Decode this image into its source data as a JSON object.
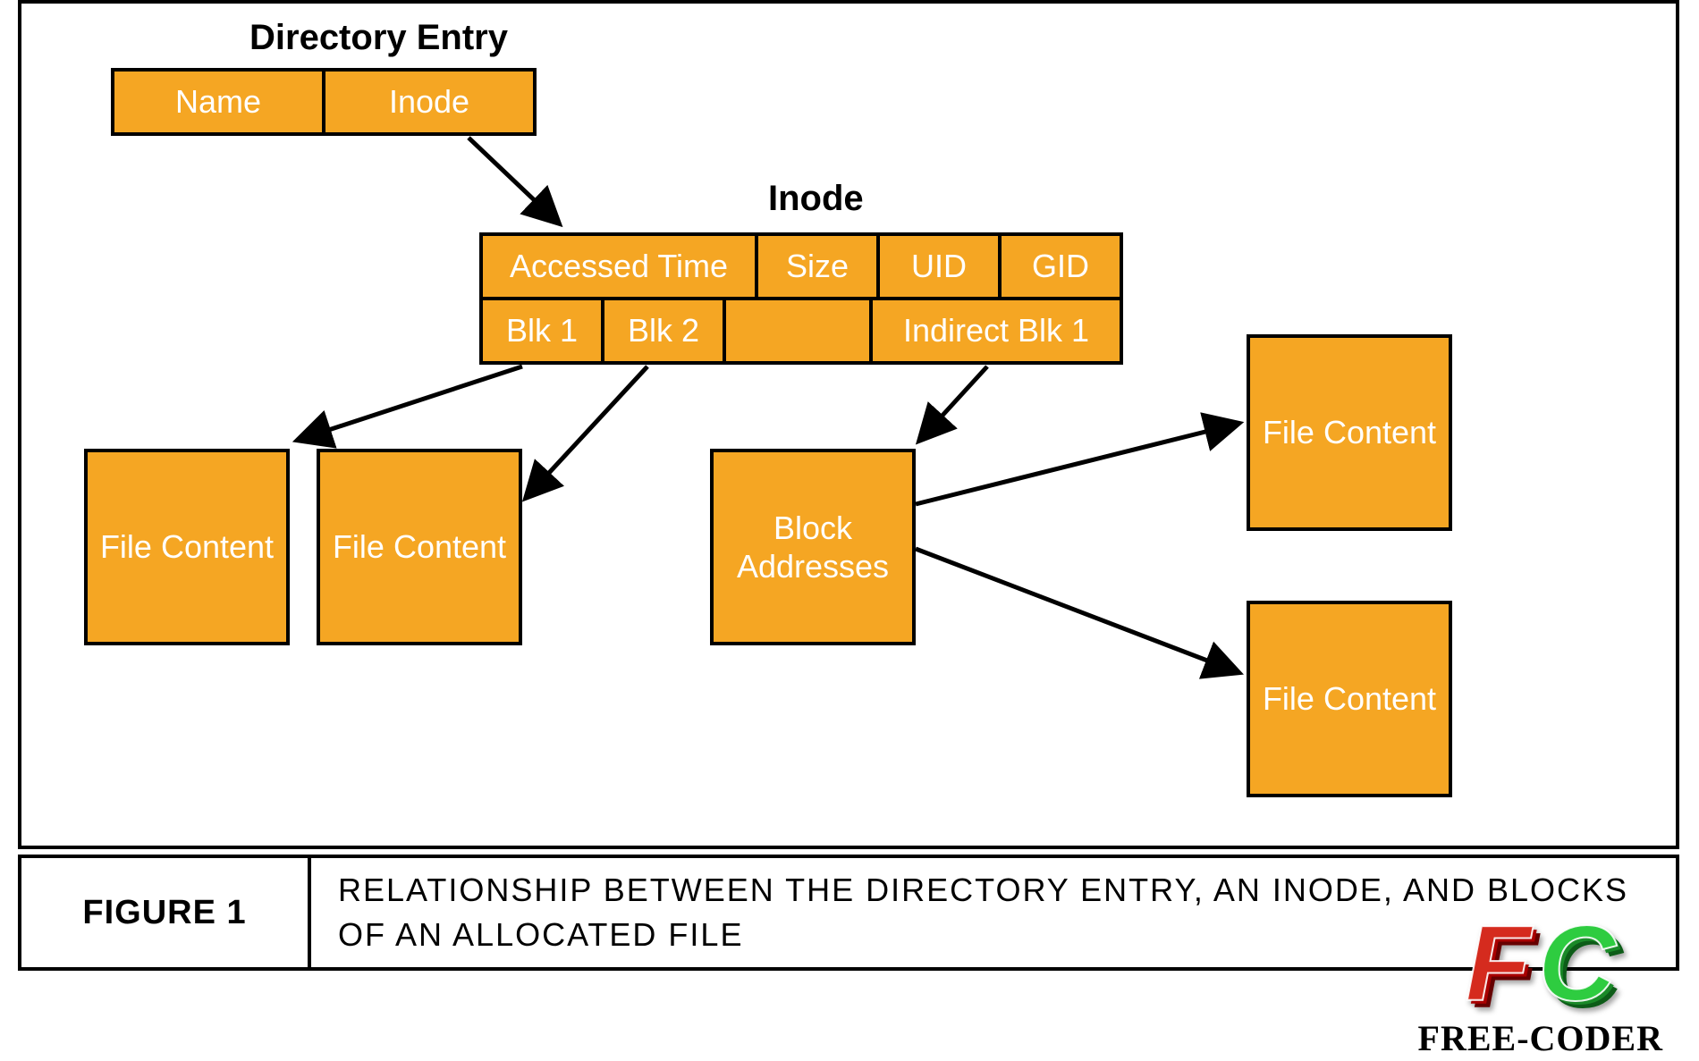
{
  "headings": {
    "directory_entry": "Directory Entry",
    "inode": "Inode"
  },
  "directory_entry": {
    "name": "Name",
    "inode": "Inode"
  },
  "inode_row1": {
    "accessed_time": "Accessed Time",
    "size": "Size",
    "uid": "UID",
    "gid": "GID"
  },
  "inode_row2": {
    "blk1": "Blk 1",
    "blk2": "Blk 2",
    "empty": "",
    "indirect_blk1": "Indirect Blk 1"
  },
  "blocks": {
    "file_content": "File Content",
    "block_addresses": "Block Addresses"
  },
  "caption": {
    "label": "FIGURE 1",
    "text": "RELATIONSHIP BETWEEN THE DIRECTORY ENTRY, AN INODE, AND BLOCKS OF AN ALLOCATED FILE"
  },
  "watermark": {
    "letter_f": "F",
    "letter_c": "C",
    "text": "FREE-CODER"
  }
}
